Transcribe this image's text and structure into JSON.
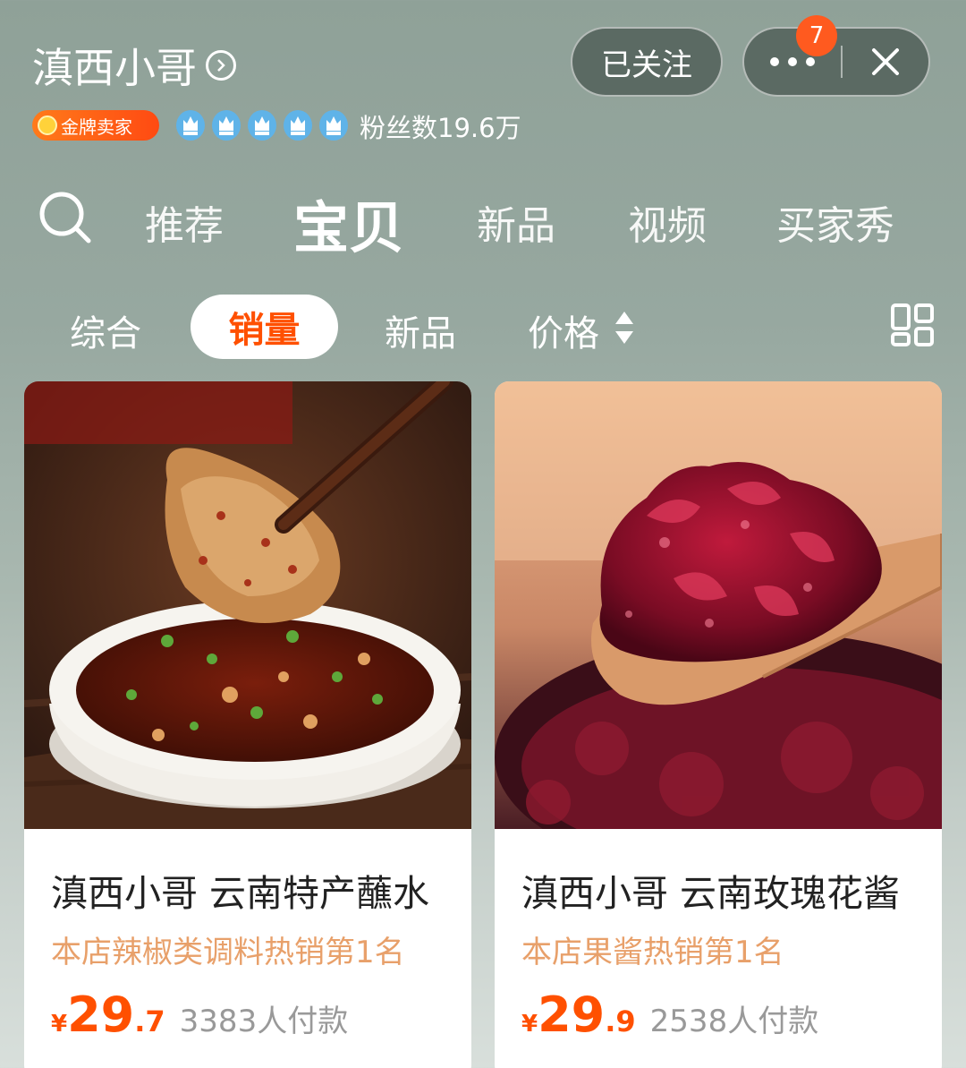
{
  "header": {
    "shop_name": "滇西小哥",
    "follow_label": "已关注",
    "notification_count": "7",
    "seller_badge": "金牌卖家",
    "fans_text": "粉丝数19.6万"
  },
  "top_tabs": [
    "推荐",
    "宝贝",
    "新品",
    "视频",
    "买家秀"
  ],
  "active_top_tab": "宝贝",
  "sort_bar": {
    "items": [
      "综合",
      "销量",
      "新品",
      "价格"
    ],
    "active": "销量"
  },
  "products": [
    {
      "title": "滇西小哥 云南特产蘸水",
      "tag": "本店辣椒类调料热销第1名",
      "currency": "¥",
      "price_int": "29",
      "price_dec": ".7",
      "sold": "3383人付款"
    },
    {
      "title": "滇西小哥 云南玫瑰花酱",
      "tag": "本店果酱热销第1名",
      "currency": "¥",
      "price_int": "29",
      "price_dec": ".9",
      "sold": "2538人付款"
    }
  ],
  "colors": {
    "accent": "#ff5000",
    "badge": "#ff5a1f",
    "tag": "#e8a06a"
  }
}
